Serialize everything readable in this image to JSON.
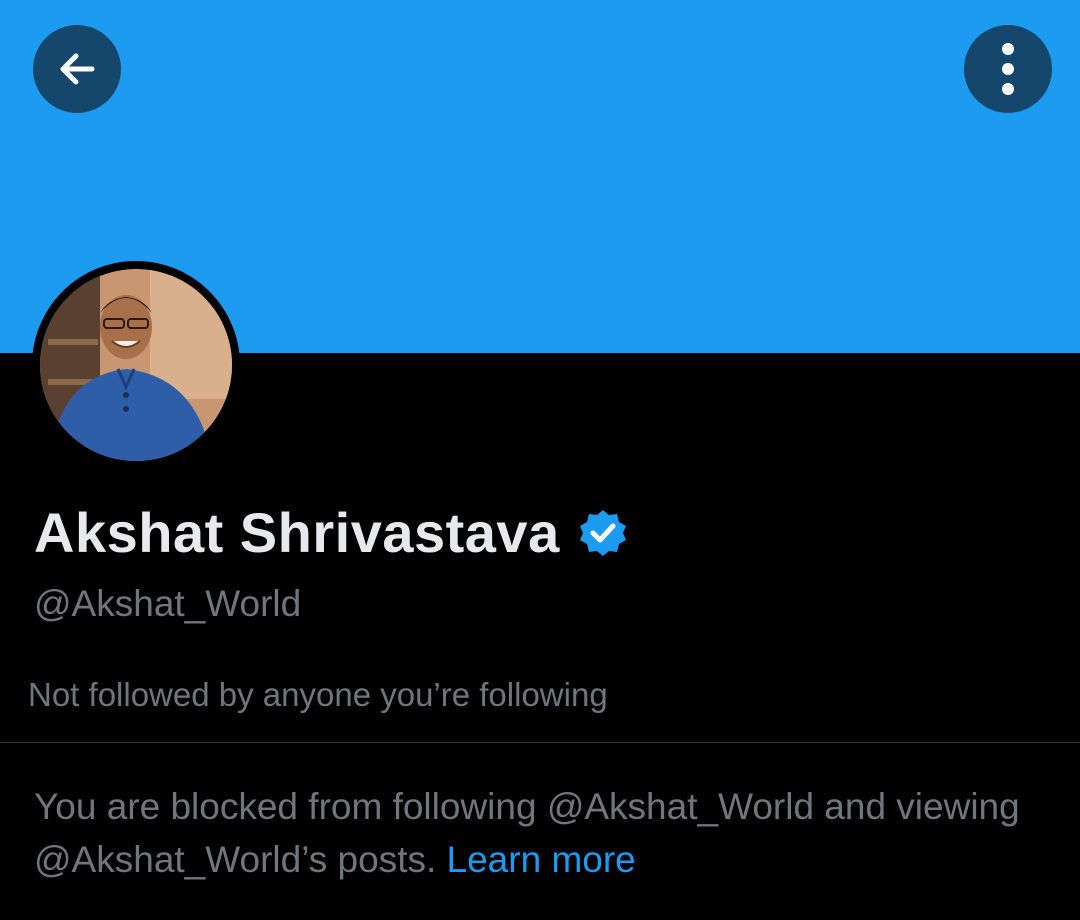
{
  "header": {
    "back_icon": "arrow-left-icon",
    "more_icon": "more-vertical-icon",
    "banner_color": "#1d9bf0"
  },
  "profile": {
    "display_name": "Akshat Shrivastava",
    "verified_icon": "verified-badge-icon",
    "handle": "@Akshat_World",
    "followers_note": "Not followed by anyone you’re following"
  },
  "blocked": {
    "message": "You are blocked from following @Akshat_World and viewing @Akshat_World’s posts.",
    "learn_more": "Learn more"
  },
  "colors": {
    "accent": "#1d9bf0",
    "background": "#000000",
    "secondary_text": "#71767b",
    "primary_text": "#e7e9ea"
  }
}
